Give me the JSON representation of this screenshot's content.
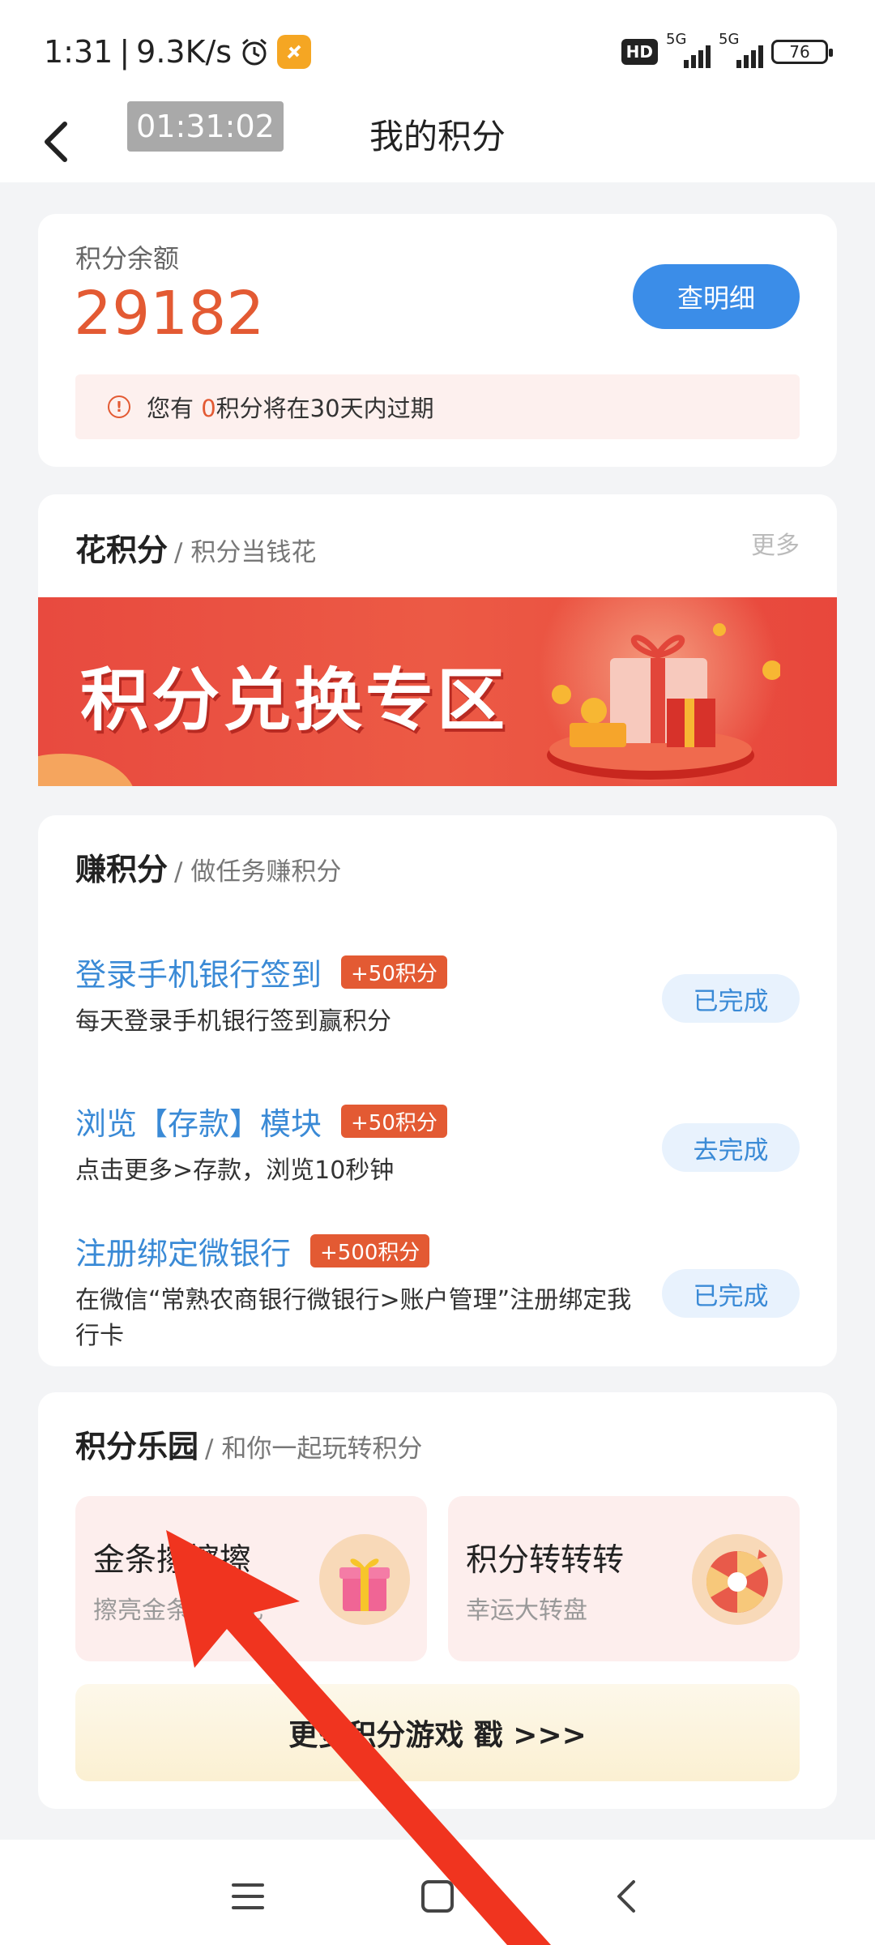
{
  "status_bar": {
    "time": "1:31",
    "speed": "9.3K/s",
    "network_1": "5G",
    "network_2": "5G",
    "hd_label": "HD",
    "battery": "76"
  },
  "nav": {
    "timer": "01:31:02",
    "title": "我的积分"
  },
  "balance": {
    "label": "积分余额",
    "value": "29182",
    "detail_button": "查明细",
    "expire_prefix": "您有 ",
    "expire_count": "0",
    "expire_suffix": "积分将在30天内过期"
  },
  "spend": {
    "title": "花积分",
    "subtitle": "/ 积分当钱花",
    "more": "更多",
    "banner_text": "积分兑换专区"
  },
  "earn": {
    "title": "赚积分",
    "subtitle": "/ 做任务赚积分",
    "tasks": [
      {
        "title": "登录手机银行签到",
        "badge": "+50积分",
        "desc": "每天登录手机银行签到赢积分",
        "button": "已完成"
      },
      {
        "title": "浏览【存款】模块",
        "badge": "+50积分",
        "desc": "点击更多>存款，浏览10秒钟",
        "button": "去完成"
      },
      {
        "title": "注册绑定微银行",
        "badge": "+500积分",
        "desc": "在微信“常熟农商银行微银行>账户管理”注册绑定我行卡",
        "button": "已完成"
      }
    ]
  },
  "play": {
    "title": "积分乐园",
    "subtitle": "/ 和你一起玩转积分",
    "games": [
      {
        "title": "金条擦擦擦",
        "subtitle": "擦亮金条赢好礼"
      },
      {
        "title": "积分转转转",
        "subtitle": "幸运大转盘"
      }
    ],
    "more_games": "更多积分游戏 戳 >>>"
  },
  "colors": {
    "accent_blue": "#3b8de8",
    "accent_red": "#e35a33",
    "annotation_arrow": "#f0341f"
  }
}
